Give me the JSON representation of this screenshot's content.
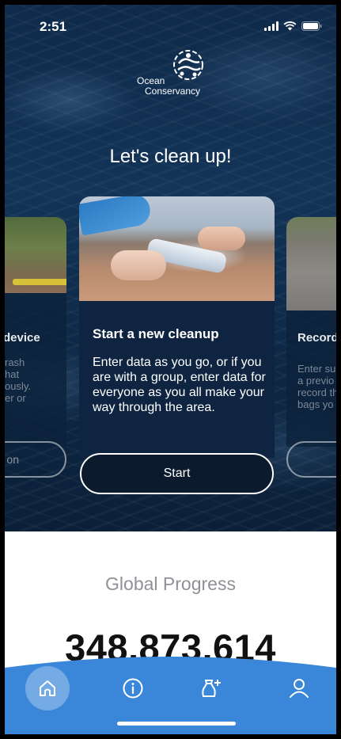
{
  "status_bar": {
    "time": "2:51",
    "icons": [
      "signal-icon",
      "wifi-icon",
      "battery-icon"
    ]
  },
  "logo": {
    "line1": "Ocean",
    "line2": "Conservancy",
    "mark": "ocean-conservancy-logo"
  },
  "headline": "Let's clean up!",
  "cards": [
    {
      "title": "device",
      "description": "rash\nhat\nously.\ner or",
      "button": "on"
    },
    {
      "title": "Start a new cleanup",
      "description": "Enter data as you go, or if you are with a group, enter data for everyone as you all make your way through the area.",
      "button": "Start"
    },
    {
      "title": "Record",
      "description": "Enter su\na previo\nrecord th\nbags yo",
      "button": ""
    }
  ],
  "progress": {
    "label": "Global Progress",
    "count": "348,873,614"
  },
  "tab_bar": {
    "accent": "#3a87d9",
    "items": [
      "home-icon",
      "info-icon",
      "add-user-icon",
      "profile-icon"
    ]
  }
}
